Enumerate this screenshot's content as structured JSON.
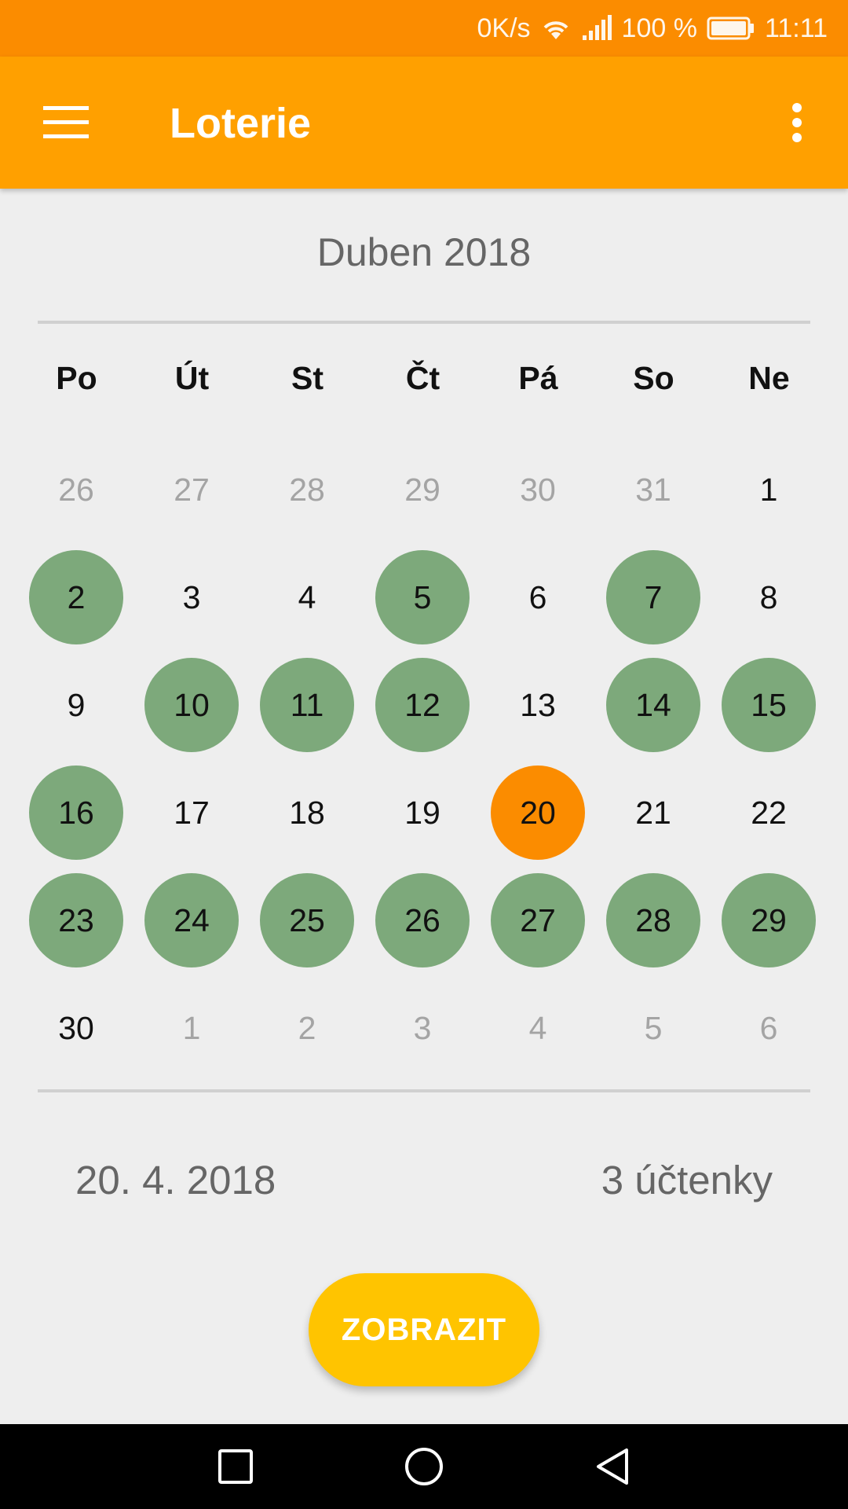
{
  "status_bar": {
    "speed": "0K/s",
    "battery": "100 %",
    "time": "11:11",
    "icons": [
      "wifi-icon",
      "signal-icon",
      "battery-icon"
    ]
  },
  "app_bar": {
    "title": "Loterie",
    "menu_icon": "hamburger-menu-icon",
    "overflow_icon": "more-vert-icon"
  },
  "calendar": {
    "month_label": "Duben 2018",
    "weekdays": [
      "Po",
      "Út",
      "St",
      "Čt",
      "Pá",
      "So",
      "Ne"
    ],
    "weeks": [
      [
        {
          "d": "26",
          "state": "muted"
        },
        {
          "d": "27",
          "state": "muted"
        },
        {
          "d": "28",
          "state": "muted"
        },
        {
          "d": "29",
          "state": "muted"
        },
        {
          "d": "30",
          "state": "muted"
        },
        {
          "d": "31",
          "state": "muted"
        },
        {
          "d": "1",
          "state": "normal"
        }
      ],
      [
        {
          "d": "2",
          "state": "marked"
        },
        {
          "d": "3",
          "state": "normal"
        },
        {
          "d": "4",
          "state": "normal"
        },
        {
          "d": "5",
          "state": "marked"
        },
        {
          "d": "6",
          "state": "normal"
        },
        {
          "d": "7",
          "state": "marked"
        },
        {
          "d": "8",
          "state": "normal"
        }
      ],
      [
        {
          "d": "9",
          "state": "normal"
        },
        {
          "d": "10",
          "state": "marked"
        },
        {
          "d": "11",
          "state": "marked"
        },
        {
          "d": "12",
          "state": "marked"
        },
        {
          "d": "13",
          "state": "normal"
        },
        {
          "d": "14",
          "state": "marked"
        },
        {
          "d": "15",
          "state": "marked"
        }
      ],
      [
        {
          "d": "16",
          "state": "marked"
        },
        {
          "d": "17",
          "state": "normal"
        },
        {
          "d": "18",
          "state": "normal"
        },
        {
          "d": "19",
          "state": "normal"
        },
        {
          "d": "20",
          "state": "selected"
        },
        {
          "d": "21",
          "state": "normal"
        },
        {
          "d": "22",
          "state": "normal"
        }
      ],
      [
        {
          "d": "23",
          "state": "marked"
        },
        {
          "d": "24",
          "state": "marked"
        },
        {
          "d": "25",
          "state": "marked"
        },
        {
          "d": "26",
          "state": "marked"
        },
        {
          "d": "27",
          "state": "marked"
        },
        {
          "d": "28",
          "state": "marked"
        },
        {
          "d": "29",
          "state": "marked"
        }
      ],
      [
        {
          "d": "30",
          "state": "normal"
        },
        {
          "d": "1",
          "state": "muted"
        },
        {
          "d": "2",
          "state": "muted"
        },
        {
          "d": "3",
          "state": "muted"
        },
        {
          "d": "4",
          "state": "muted"
        },
        {
          "d": "5",
          "state": "muted"
        },
        {
          "d": "6",
          "state": "muted"
        }
      ]
    ]
  },
  "summary": {
    "selected_date": "20. 4. 2018",
    "receipt_count": "3 účtenky"
  },
  "action": {
    "show_label": "ZOBRAZIT"
  },
  "nav_bar": {
    "icons": [
      "recents-square-icon",
      "home-circle-icon",
      "back-triangle-icon"
    ]
  },
  "colors": {
    "status_bar": "#fb8c00",
    "app_bar": "#ffa000",
    "marked_day": "#7da97b",
    "selected_day": "#fb8c00",
    "button": "#ffc400",
    "background": "#eeeeee"
  }
}
